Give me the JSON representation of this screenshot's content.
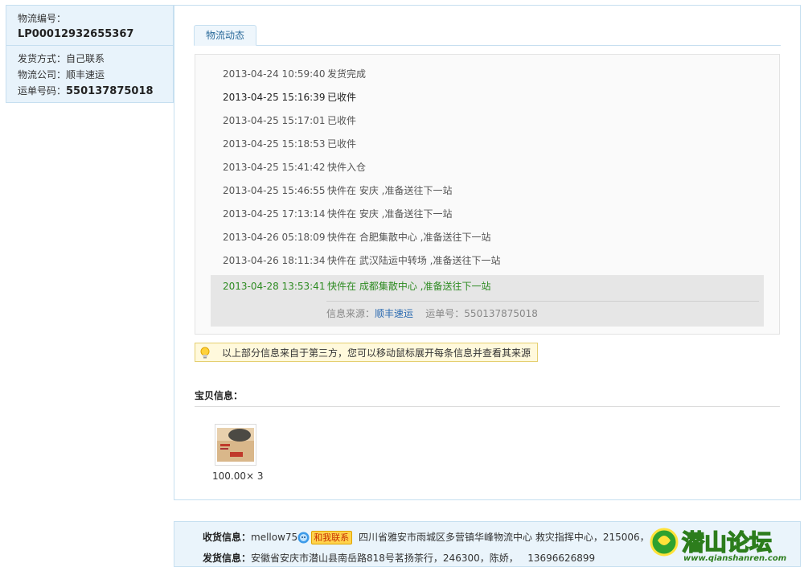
{
  "left": {
    "order_label": "物流编号：",
    "order_no": "LP00012932655367",
    "ship_method": "发货方式：自己联系",
    "company": "物流公司：顺丰速运",
    "waybill_label": "运单号码：",
    "waybill_no": "550137875018"
  },
  "tab": {
    "label": "物流动态"
  },
  "events": [
    {
      "time": "2013-04-24 10:59:40",
      "desc": "发货完成"
    },
    {
      "time": "2013-04-25 15:16:39",
      "desc": "已收件"
    },
    {
      "time": "2013-04-25 15:17:01",
      "desc": "已收件"
    },
    {
      "time": "2013-04-25 15:18:53",
      "desc": "已收件"
    },
    {
      "time": "2013-04-25 15:41:42",
      "desc": "快件入仓"
    },
    {
      "time": "2013-04-25 15:46:55",
      "desc": "快件在 安庆 ,准备送往下一站"
    },
    {
      "time": "2013-04-25 17:13:14",
      "desc": "快件在 安庆 ,准备送往下一站"
    },
    {
      "time": "2013-04-26 05:18:09",
      "desc": "快件在 合肥集散中心 ,准备送往下一站"
    },
    {
      "time": "2013-04-26 18:11:34",
      "desc": "快件在 武汉陆运中转场 ,准备送往下一站"
    }
  ],
  "latest": {
    "time": "2013-04-28 13:53:41",
    "desc": "快件在 成都集散中心 ,准备送往下一站",
    "source_label": "信息来源：",
    "source_name": "顺丰速运",
    "waybill_text": "运单号：550137875018"
  },
  "tip": "以上部分信息来自于第三方，您可以移动鼠标展开每条信息并查看其来源",
  "goods": {
    "title": "宝贝信息：",
    "price": "100.00× 3"
  },
  "bottom": {
    "receive_label": "收货信息：",
    "receive_user": "mellow75",
    "contact_label": "和我联系",
    "receive_addr": "四川省雅安市雨城区多营镇华峰物流中心 救灾指挥中心，215006，",
    "send_label": "发货信息：",
    "send_addr": "安徽省安庆市潜山县南岳路818号茗扬茶行，246300，陈娇，",
    "send_phone": "13696626899"
  },
  "watermark": {
    "name": "潜山论坛",
    "url": "www.qianshanren.com"
  },
  "colors": {
    "accent_blue": "#2a6ab0",
    "latest_green": "#2e8b22",
    "panel_border": "#c6dff0"
  }
}
